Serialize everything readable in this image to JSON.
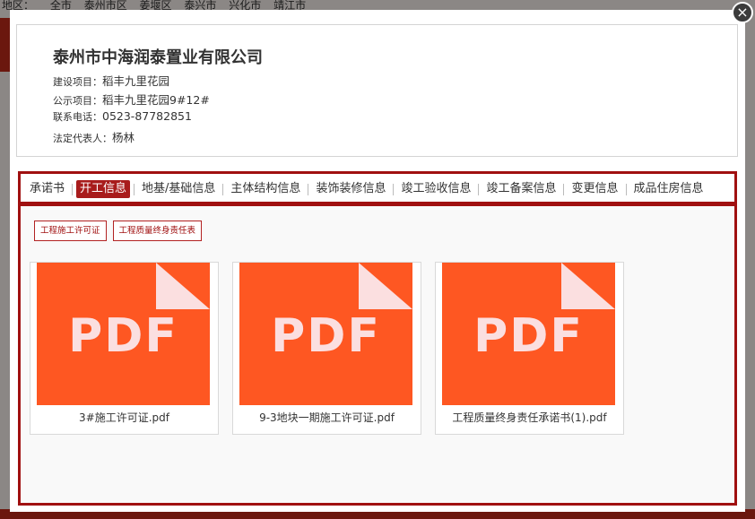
{
  "background": {
    "region_label": "地区：",
    "regions": [
      "全市",
      "泰州市区",
      "姜堰区",
      "泰兴市",
      "兴化市",
      "靖江市"
    ]
  },
  "modal": {
    "close_glyph": "×",
    "company_name": "泰州市中海润泰置业有限公司",
    "info": [
      {
        "label": "建设项目：",
        "value": "稻丰九里花园"
      },
      {
        "label": "公示项目：",
        "value": "稻丰九里花园9#12#"
      },
      {
        "label": "联系电话：",
        "value": "0523-87782851"
      },
      {
        "label": "法定代表人：",
        "value": "杨林"
      }
    ],
    "tabs": [
      "承诺书",
      "开工信息",
      "地基/基础信息",
      "主体结构信息",
      "装饰装修信息",
      "竣工验收信息",
      "竣工备案信息",
      "变更信息",
      "成品住房信息"
    ],
    "active_tab": "开工信息",
    "sub_buttons": [
      "工程施工许可证",
      "工程质量终身责任表"
    ],
    "files": [
      {
        "thumb_text": "PDF",
        "name": "3#施工许可证.pdf"
      },
      {
        "thumb_text": "PDF",
        "name": "9-3地块一期施工许可证.pdf"
      },
      {
        "thumb_text": "PDF",
        "name": "工程质量终身责任承诺书(1).pdf"
      }
    ]
  },
  "colors": {
    "accent_red": "#a01010",
    "pdf_orange": "#fe5722",
    "pdf_text": "#fbdfe0"
  }
}
